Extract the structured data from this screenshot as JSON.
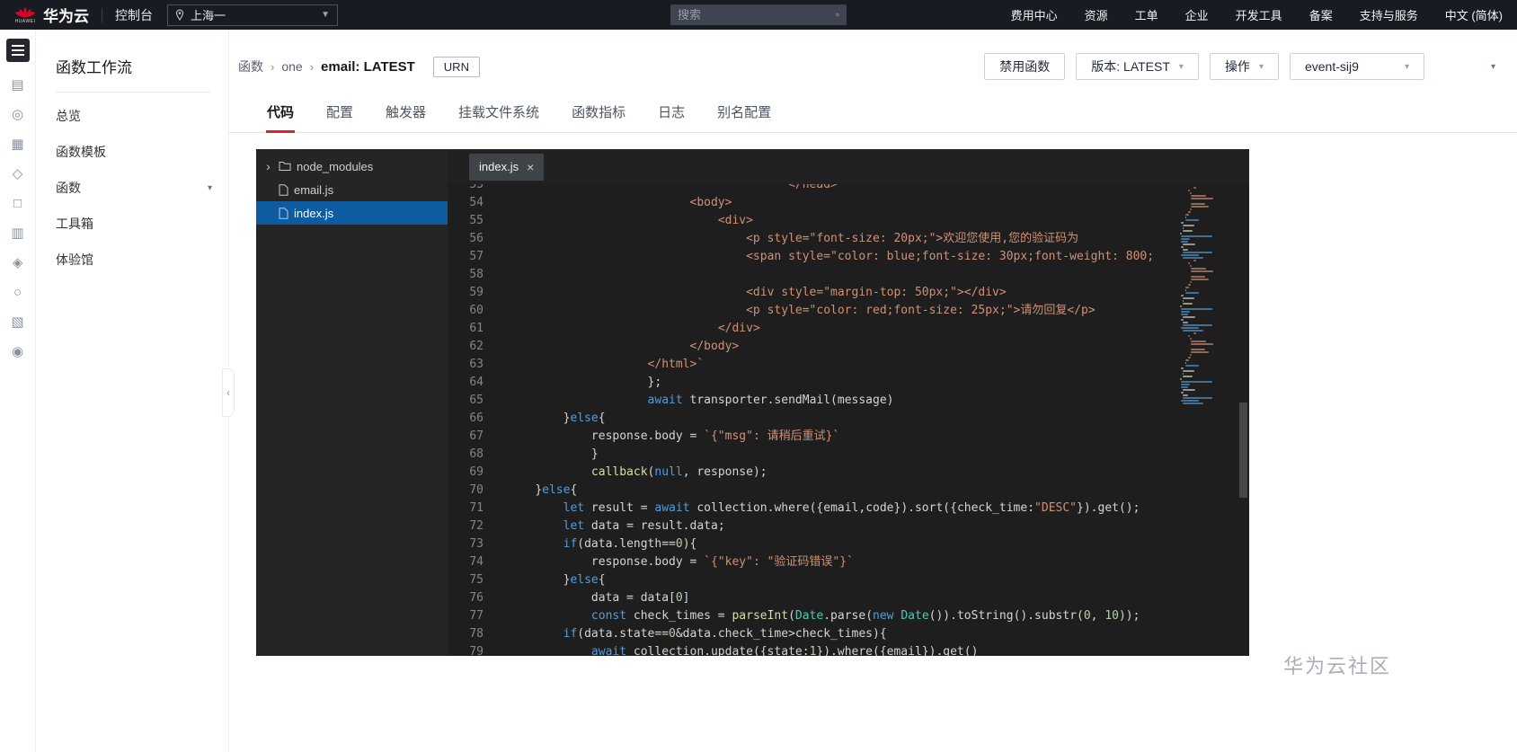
{
  "colors": {
    "accent": "#e41e2c",
    "topnav_bg": "#181b22",
    "selection": "#0d5ba1",
    "editor_bg": "#1e1e1e",
    "panel_bg": "#252526"
  },
  "topnav": {
    "logo_text": "HUAWEI",
    "brand": "华为云",
    "console_label": "控制台",
    "region": "上海一",
    "search_placeholder": "搜索",
    "menu": [
      "费用中心",
      "资源",
      "工单",
      "企业",
      "开发工具",
      "备案",
      "支持与服务",
      "中文 (简体)"
    ]
  },
  "rail": {
    "icons": [
      "▤",
      "◎",
      "▦",
      "◇",
      "□",
      "▥",
      "◈",
      "○",
      "▧",
      "◉"
    ]
  },
  "sidebar": {
    "title": "函数工作流",
    "items": [
      {
        "label": "总览",
        "caret": false
      },
      {
        "label": "函数模板",
        "caret": false
      },
      {
        "label": "函数",
        "caret": true
      },
      {
        "label": "工具箱",
        "caret": false
      },
      {
        "label": "体验馆",
        "caret": false
      }
    ]
  },
  "header": {
    "breadcrumb": [
      "函数",
      "one"
    ],
    "current": "email: LATEST",
    "urn": "URN",
    "actions": {
      "disable": "禁用函数",
      "version": "版本: LATEST",
      "operate": "操作",
      "event": "event-sij9"
    }
  },
  "tabs": {
    "items": [
      "代码",
      "配置",
      "触发器",
      "挂载文件系统",
      "函数指标",
      "日志",
      "别名配置"
    ],
    "active": 0
  },
  "editor": {
    "explorer": [
      {
        "type": "folder",
        "label": "node_modules",
        "collapsed": true
      },
      {
        "type": "file",
        "label": "email.js"
      },
      {
        "type": "file",
        "label": "index.js",
        "selected": true
      }
    ],
    "open_tab": "index.js",
    "colors": {
      "keyword": "#569cd6",
      "string": "#ce9178",
      "number": "#b5cea8",
      "type": "#4ec9b0",
      "func": "#dcdcaa",
      "default": "#d4d4d4"
    },
    "lines": [
      {
        "n": 53,
        "i": 40,
        "t": [
          [
            "s",
            "</head>"
          ]
        ]
      },
      {
        "n": 54,
        "i": 26,
        "t": [
          [
            "s",
            "<body>"
          ]
        ]
      },
      {
        "n": 55,
        "i": 30,
        "t": [
          [
            "s",
            "<div>"
          ]
        ]
      },
      {
        "n": 56,
        "i": 34,
        "t": [
          [
            "s",
            "<p style=\"font-size: 20px;\">欢迎您使用,您的验证码为"
          ]
        ]
      },
      {
        "n": 57,
        "i": 34,
        "t": [
          [
            "s",
            "<span style=\"color: blue;font-size: 30px;font-weight: 800;"
          ]
        ]
      },
      {
        "n": 58,
        "i": 0,
        "t": []
      },
      {
        "n": 59,
        "i": 34,
        "t": [
          [
            "s",
            "<div style=\"margin-top: 50px;\"></div>"
          ]
        ]
      },
      {
        "n": 60,
        "i": 34,
        "t": [
          [
            "s",
            "<p style=\"color: red;font-size: 25px;\">请勿回复</p>"
          ]
        ]
      },
      {
        "n": 61,
        "i": 30,
        "t": [
          [
            "s",
            "</div>"
          ]
        ]
      },
      {
        "n": 62,
        "i": 26,
        "t": [
          [
            "s",
            "</body>"
          ]
        ]
      },
      {
        "n": 63,
        "i": 20,
        "t": [
          [
            "s",
            "</html>`"
          ]
        ]
      },
      {
        "n": 64,
        "i": 20,
        "t": [
          [
            "d",
            "};"
          ]
        ]
      },
      {
        "n": 65,
        "i": 20,
        "t": [
          [
            "k",
            "await"
          ],
          [
            "d",
            " transporter.sendMail(message)"
          ]
        ]
      },
      {
        "n": 66,
        "i": 8,
        "t": [
          [
            "d",
            "}"
          ],
          [
            "k",
            "else"
          ],
          [
            "d",
            "{"
          ]
        ]
      },
      {
        "n": 67,
        "i": 12,
        "t": [
          [
            "d",
            "response.body = "
          ],
          [
            "s",
            "`{\"msg\": 请稍后重试}`"
          ]
        ]
      },
      {
        "n": 68,
        "i": 12,
        "t": [
          [
            "d",
            "}"
          ]
        ]
      },
      {
        "n": 69,
        "i": 12,
        "t": [
          [
            "f",
            "callback"
          ],
          [
            "d",
            "("
          ],
          [
            "k",
            "null"
          ],
          [
            "d",
            ", response);"
          ]
        ]
      },
      {
        "n": 70,
        "i": 4,
        "t": [
          [
            "d",
            "}"
          ],
          [
            "k",
            "else"
          ],
          [
            "d",
            "{"
          ]
        ]
      },
      {
        "n": 71,
        "i": 8,
        "t": [
          [
            "k",
            "let"
          ],
          [
            "d",
            " result = "
          ],
          [
            "k",
            "await"
          ],
          [
            "d",
            " collection.where({email,code}).sort({check_time:"
          ],
          [
            "s",
            "\"DESC\""
          ],
          [
            "d",
            "}).get();"
          ]
        ]
      },
      {
        "n": 72,
        "i": 8,
        "t": [
          [
            "k",
            "let"
          ],
          [
            "d",
            " data = result.data;"
          ]
        ]
      },
      {
        "n": 73,
        "i": 8,
        "t": [
          [
            "k",
            "if"
          ],
          [
            "d",
            "(data.length=="
          ],
          [
            "n",
            "0"
          ],
          [
            "d",
            "){"
          ]
        ]
      },
      {
        "n": 74,
        "i": 12,
        "t": [
          [
            "d",
            "response.body = "
          ],
          [
            "s",
            "`{\"key\": \"验证码错误\"}`"
          ]
        ]
      },
      {
        "n": 75,
        "i": 8,
        "t": [
          [
            "d",
            "}"
          ],
          [
            "k",
            "else"
          ],
          [
            "d",
            "{"
          ]
        ]
      },
      {
        "n": 76,
        "i": 12,
        "t": [
          [
            "d",
            "data = data["
          ],
          [
            "n",
            "0"
          ],
          [
            "d",
            "]"
          ]
        ]
      },
      {
        "n": 77,
        "i": 12,
        "t": [
          [
            "k",
            "const"
          ],
          [
            "d",
            " check_times = "
          ],
          [
            "f",
            "parseInt"
          ],
          [
            "d",
            "("
          ],
          [
            "t",
            "Date"
          ],
          [
            "d",
            ".parse("
          ],
          [
            "k",
            "new"
          ],
          [
            "d",
            " "
          ],
          [
            "t",
            "Date"
          ],
          [
            "d",
            "()).toString().substr("
          ],
          [
            "n",
            "0"
          ],
          [
            "d",
            ", "
          ],
          [
            "n",
            "10"
          ],
          [
            "d",
            "));"
          ]
        ]
      },
      {
        "n": 78,
        "i": 8,
        "t": [
          [
            "k",
            "if"
          ],
          [
            "d",
            "(data.state=="
          ],
          [
            "n",
            "0"
          ],
          [
            "d",
            "&data.check_time>check_times){"
          ]
        ]
      },
      {
        "n": 79,
        "i": 12,
        "t": [
          [
            "k",
            "await"
          ],
          [
            "d",
            " collection.update({state:"
          ],
          [
            "n",
            "1"
          ],
          [
            "d",
            "}).where({email}).get()"
          ]
        ]
      }
    ]
  },
  "watermark": "华为云社区"
}
